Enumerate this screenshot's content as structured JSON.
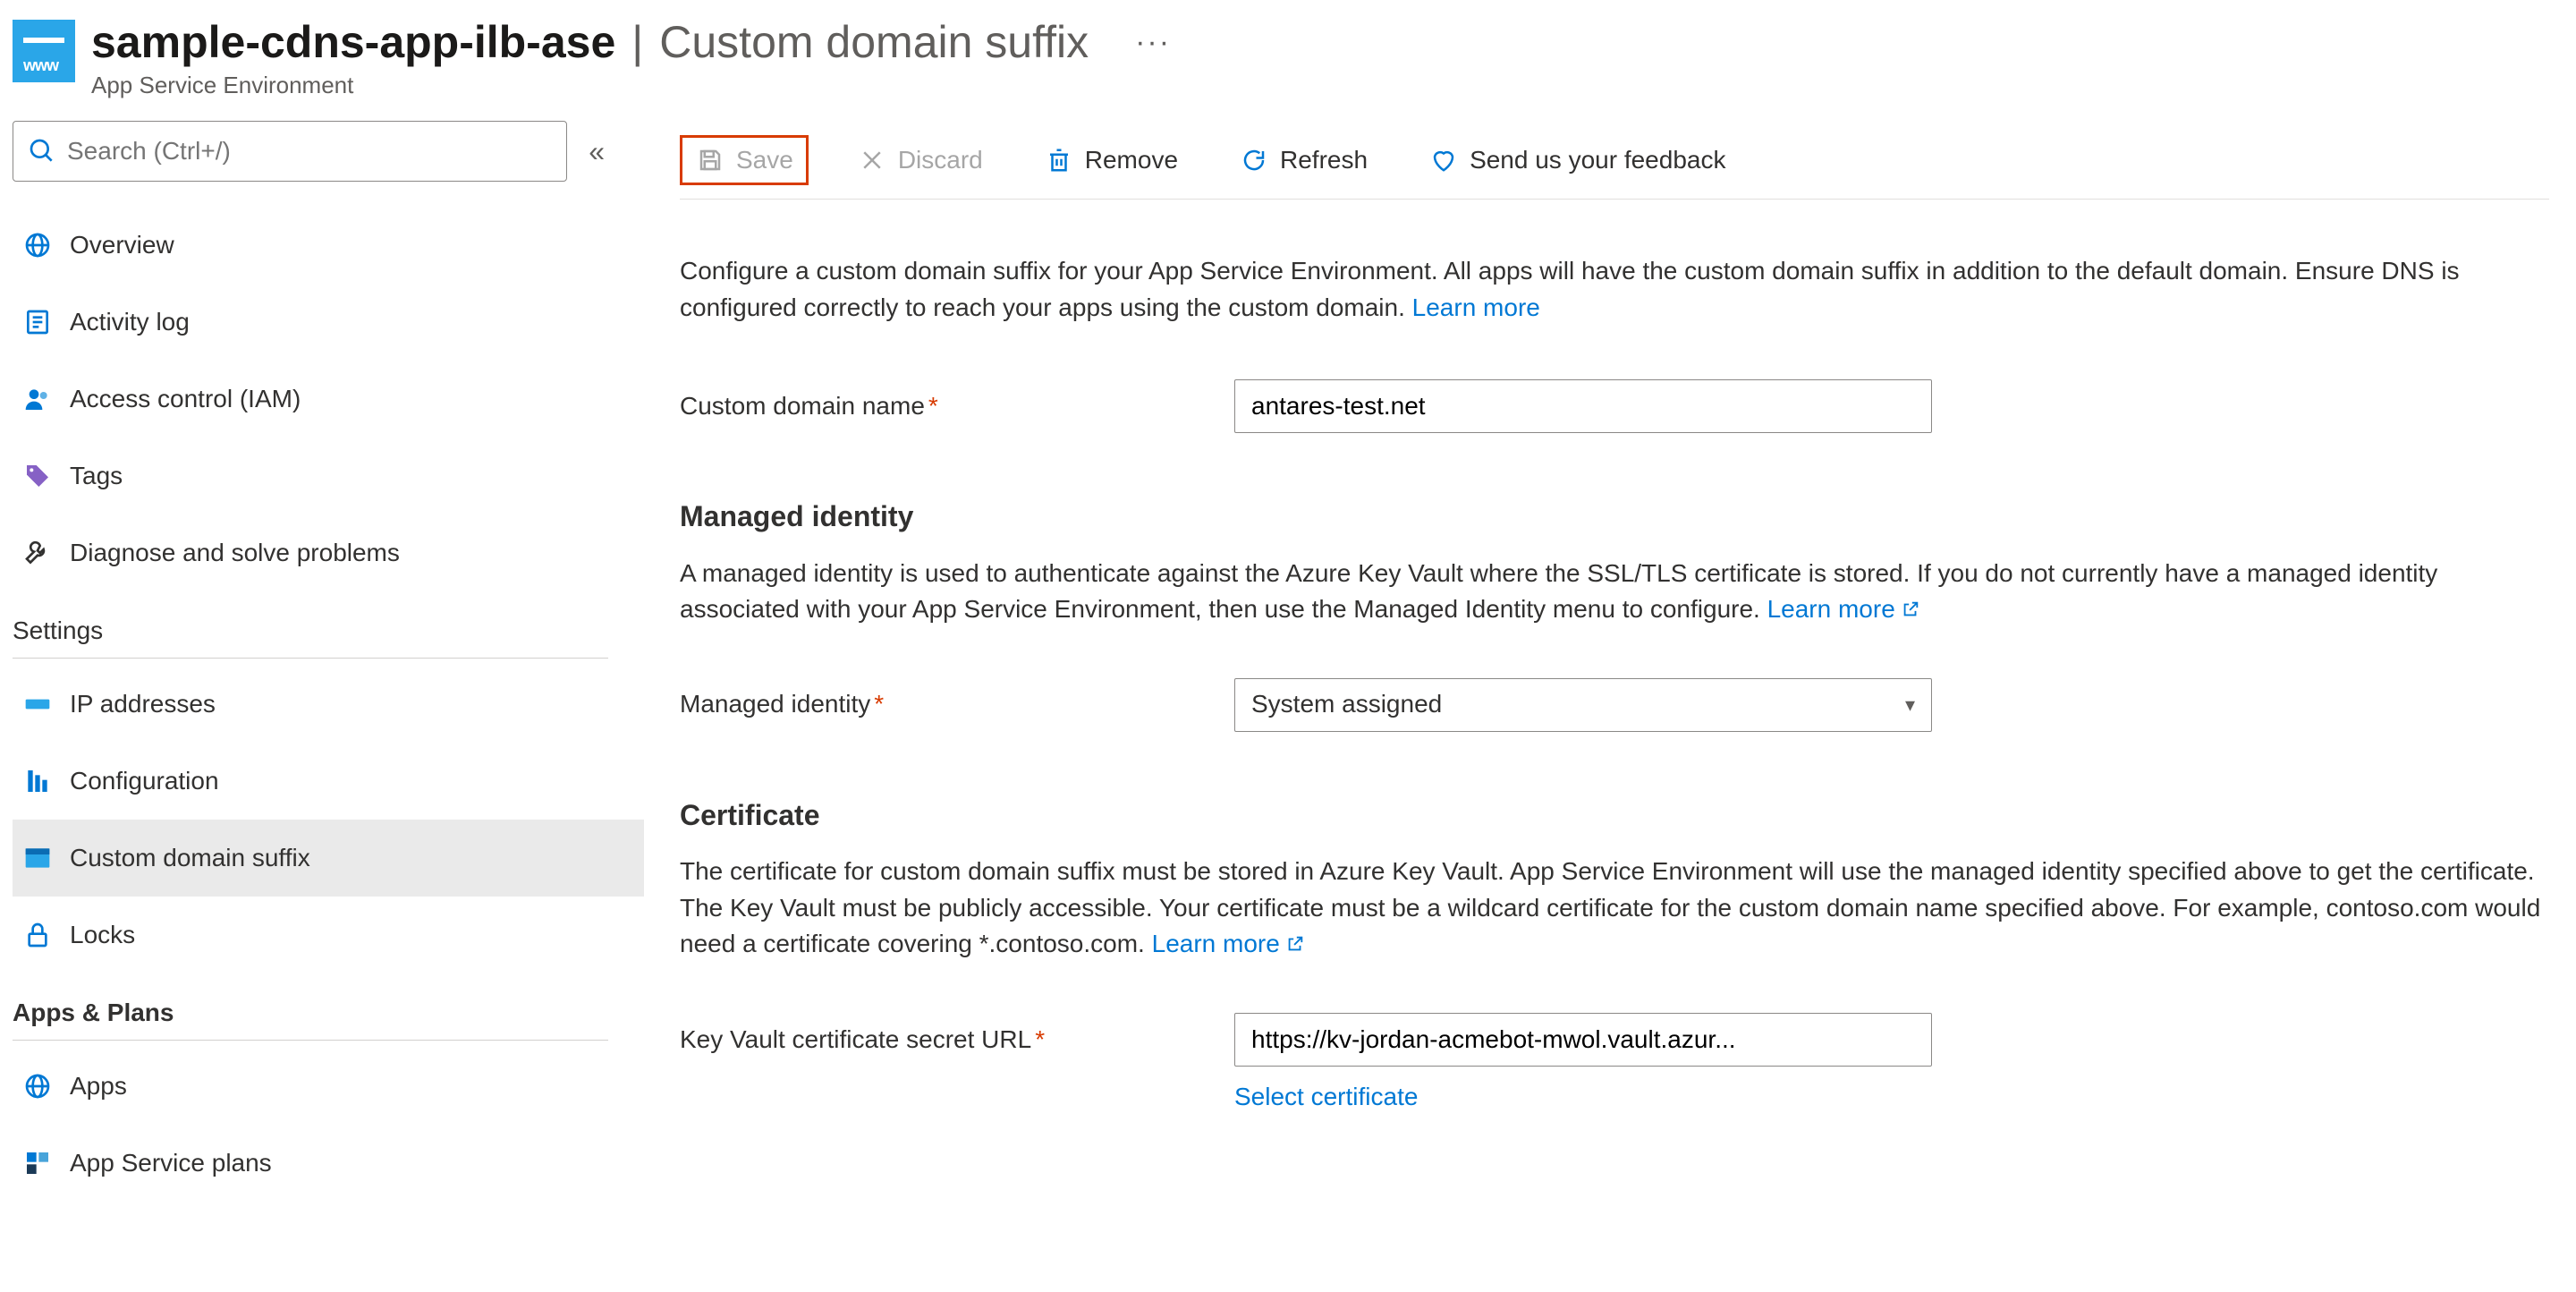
{
  "header": {
    "resource_name": "sample-cdns-app-ilb-ase",
    "page_name": "Custom domain suffix",
    "subtitle": "App Service Environment",
    "more": "···"
  },
  "sidebar": {
    "search_placeholder": "Search (Ctrl+/)",
    "items_main": [
      {
        "label": "Overview",
        "icon": "globe"
      },
      {
        "label": "Activity log",
        "icon": "log"
      },
      {
        "label": "Access control (IAM)",
        "icon": "people"
      },
      {
        "label": "Tags",
        "icon": "tag"
      },
      {
        "label": "Diagnose and solve problems",
        "icon": "wrench"
      }
    ],
    "section_settings": "Settings",
    "items_settings": [
      {
        "label": "IP addresses",
        "icon": "ip"
      },
      {
        "label": "Configuration",
        "icon": "bars"
      },
      {
        "label": "Custom domain suffix",
        "icon": "www",
        "selected": true
      },
      {
        "label": "Locks",
        "icon": "lock"
      }
    ],
    "section_apps": "Apps & Plans",
    "items_apps": [
      {
        "label": "Apps",
        "icon": "globe"
      },
      {
        "label": "App Service plans",
        "icon": "plan"
      }
    ]
  },
  "toolbar": {
    "save_label": "Save",
    "discard_label": "Discard",
    "remove_label": "Remove",
    "refresh_label": "Refresh",
    "feedback_label": "Send us your feedback"
  },
  "content": {
    "description": "Configure a custom domain suffix for your App Service Environment. All apps will have the custom domain suffix in addition to the default domain. Ensure DNS is configured correctly to reach your apps using the custom domain. ",
    "learn_more": "Learn more",
    "custom_domain_label": "Custom domain name",
    "custom_domain_value": "antares-test.net",
    "managed_identity_heading": "Managed identity",
    "managed_identity_body": "A managed identity is used to authenticate against the Azure Key Vault where the SSL/TLS certificate is stored. If you do not currently have a managed identity associated with your App Service Environment, then use the Managed Identity menu to configure. ",
    "managed_identity_label": "Managed identity",
    "managed_identity_value": "System assigned",
    "certificate_heading": "Certificate",
    "certificate_body": "The certificate for custom domain suffix must be stored in Azure Key Vault. App Service Environment will use the managed identity specified above to get the certificate. The Key Vault must be publicly accessible. Your certificate must be a wildcard certificate for the custom domain name specified above. For example, contoso.com would need a certificate covering *.contoso.com. ",
    "keyvault_label": "Key Vault certificate secret URL",
    "keyvault_value": "https://kv-jordan-acmebot-mwol.vault.azur...",
    "select_certificate": "Select certificate"
  }
}
